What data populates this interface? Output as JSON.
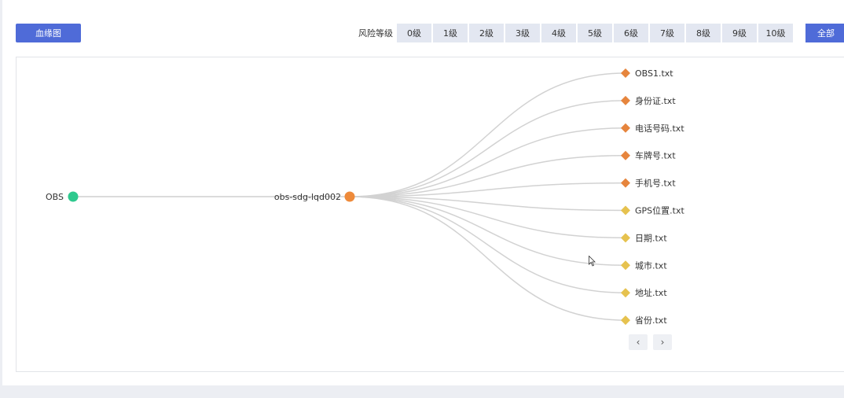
{
  "toolbar": {
    "lineage_tab": "血缘图",
    "risk_label": "风险等级",
    "levels": [
      "0级",
      "1级",
      "2级",
      "3级",
      "4级",
      "5级",
      "6级",
      "7级",
      "8级",
      "9级",
      "10级"
    ],
    "all_label": "全部"
  },
  "graph": {
    "source": {
      "label": "OBS",
      "color": "#2ec98e"
    },
    "bucket": {
      "label": "obs-sdg-lqd002",
      "color": "#ee8a3a"
    },
    "files": [
      {
        "label": "OBS1.txt",
        "color": "#e6853d"
      },
      {
        "label": "身份证.txt",
        "color": "#e6853d"
      },
      {
        "label": "电话号码.txt",
        "color": "#e6853d"
      },
      {
        "label": "车牌号.txt",
        "color": "#e6853d"
      },
      {
        "label": "手机号.txt",
        "color": "#e6853d"
      },
      {
        "label": "GPS位置.txt",
        "color": "#e6c24f"
      },
      {
        "label": "日期.txt",
        "color": "#e6c24f"
      },
      {
        "label": "城市.txt",
        "color": "#e6c24f"
      },
      {
        "label": "地址.txt",
        "color": "#e6c24f"
      },
      {
        "label": "省份.txt",
        "color": "#e6c24f"
      }
    ]
  },
  "pager": {
    "prev_icon": "chevron-left-icon",
    "next_icon": "chevron-right-icon"
  }
}
